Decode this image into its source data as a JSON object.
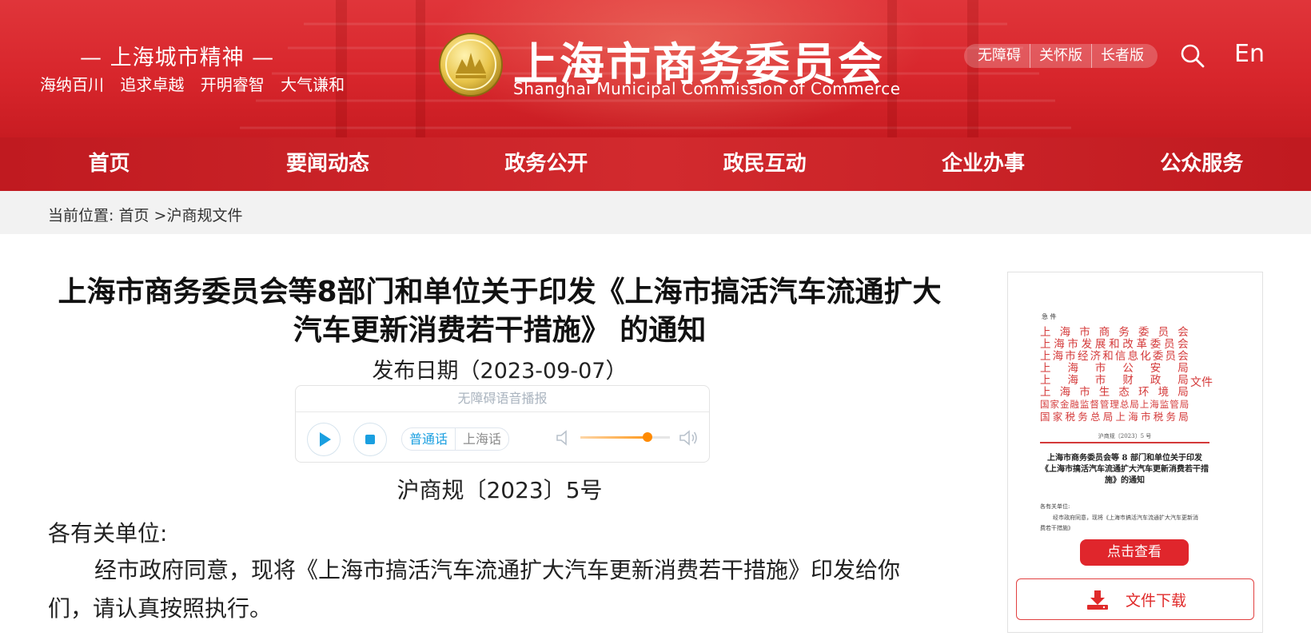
{
  "header": {
    "slogan_title": "— 上海城市精神 —",
    "slogan_items": [
      "海纳百川",
      "追求卓越",
      "开明睿智",
      "大气谦和"
    ],
    "emblem_icon": "shanghai-emblem-icon",
    "org_name_cn": "上海市商务委员会",
    "org_name_en": "Shanghai Municipal Commission of Commerce",
    "accessibility_buttons": [
      "无障碍",
      "关怀版",
      "长者版"
    ],
    "search_icon": "search-icon",
    "language_button": "En"
  },
  "nav": {
    "items": [
      "首页",
      "要闻动态",
      "政务公开",
      "政民互动",
      "企业办事",
      "公众服务"
    ]
  },
  "breadcrumb": {
    "prefix": "当前位置:",
    "home": "首页",
    "separator": ">",
    "current": "沪商规文件"
  },
  "article": {
    "title": "上海市商务委员会等8部门和单位关于印发《上海市搞活汽车流通扩大汽车更新消费若干措施》 的通知",
    "publish_date": "发布日期（2023-09-07）",
    "doc_number": "沪商规〔2023〕5号",
    "salutation": "各有关单位:",
    "body": "经市政府同意，现将《上海市搞活汽车流通扩大汽车更新消费若干措施》印发给你们，请认真按照执行。"
  },
  "player": {
    "header": "无障碍语音播报",
    "play_icon": "play-icon",
    "stop_icon": "stop-icon",
    "dialects": [
      "普通话",
      "上海话"
    ],
    "selected_dialect": "普通话",
    "volume_level": 0.75,
    "volume_low_icon": "volume-low-icon",
    "volume_high_icon": "volume-high-icon",
    "accent_color": "#1a9fe0",
    "volume_color": "#ff8a00"
  },
  "side_panel": {
    "thumb_tag": "急 件",
    "thumb_orgs": [
      "上 海 市 商 务 委 员 会",
      "上海市发展和改革委员会",
      "上海市经济和信息化委员会",
      "上 海 市 公 安 局",
      "上 海 市 财 政 局",
      "上 海 市 生 态 环 境 局",
      "国家金融监督管理总局上海监管局",
      "国家税务总局上海市税务局"
    ],
    "thumb_file_word": "文件",
    "thumb_doc_no": "沪商规〔2023〕5 号",
    "thumb_title": "上海市商务委员会等 8 部门和单位关于印发《上海市搞活汽车流通扩大汽车更新消费若干措施》的通知",
    "thumb_salutation": "各有关单位:",
    "thumb_body_1": "经市政府同意，现将《上海市搞活汽车流通扩大汽车更新消",
    "thumb_body_2": "费若干措施》",
    "view_button": "点击查看",
    "download_label": "文件下载",
    "download_icon": "download-icon"
  },
  "colors": {
    "brand_red": "#d8262c",
    "nav_red": "#c81c22",
    "doc_red": "#d43a3a"
  }
}
